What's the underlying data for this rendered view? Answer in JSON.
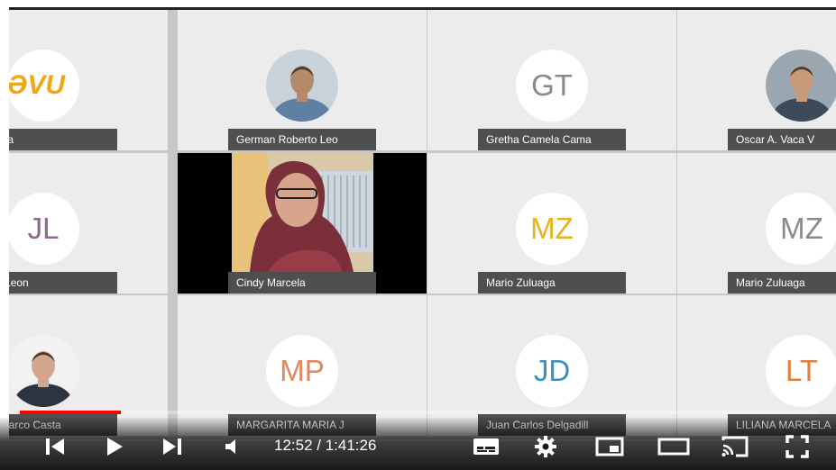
{
  "participants": [
    {
      "name": "orteava",
      "kind": "logo",
      "logo_text": "ƏVU"
    },
    {
      "name": "German Roberto Leo",
      "kind": "photo"
    },
    {
      "name": "Gretha Camela Cama",
      "kind": "initials",
      "initials": "GT",
      "color": "#8a8a8a"
    },
    {
      "name": "Oscar A. Vaca V",
      "kind": "photo"
    },
    {
      "name": "Leon Leon",
      "kind": "initials",
      "initials": "JL",
      "color": "#8a6a8a"
    },
    {
      "name": "Cindy Marcela",
      "kind": "video"
    },
    {
      "name": "Mario Zuluaga",
      "kind": "initials",
      "initials": "MZ",
      "color": "#e6b21e"
    },
    {
      "name": "Mario Zuluaga",
      "kind": "initials",
      "initials": "MZ",
      "color": "#8a8a8a"
    },
    {
      "name": "er Plutarco Casta",
      "kind": "photo"
    },
    {
      "name": "MARGARITA MARIA J",
      "kind": "initials",
      "initials": "MP",
      "color": "#e2875a"
    },
    {
      "name": "Juan Carlos Delgadill",
      "kind": "initials",
      "initials": "JD",
      "color": "#3b8fc4"
    },
    {
      "name": "LILIANA MARCELA",
      "kind": "initials",
      "initials": "LT",
      "color": "#e07f3a"
    }
  ],
  "player": {
    "time_display": "12:52 / 1:41:26",
    "progress_fraction": 0.127,
    "accent_color": "#ff0000",
    "icons": [
      "skip-previous-icon",
      "play-icon",
      "skip-next-icon",
      "volume-icon",
      "subtitles-icon",
      "settings-icon",
      "miniplayer-icon",
      "theater-mode-icon",
      "cast-icon",
      "fullscreen-icon"
    ]
  }
}
